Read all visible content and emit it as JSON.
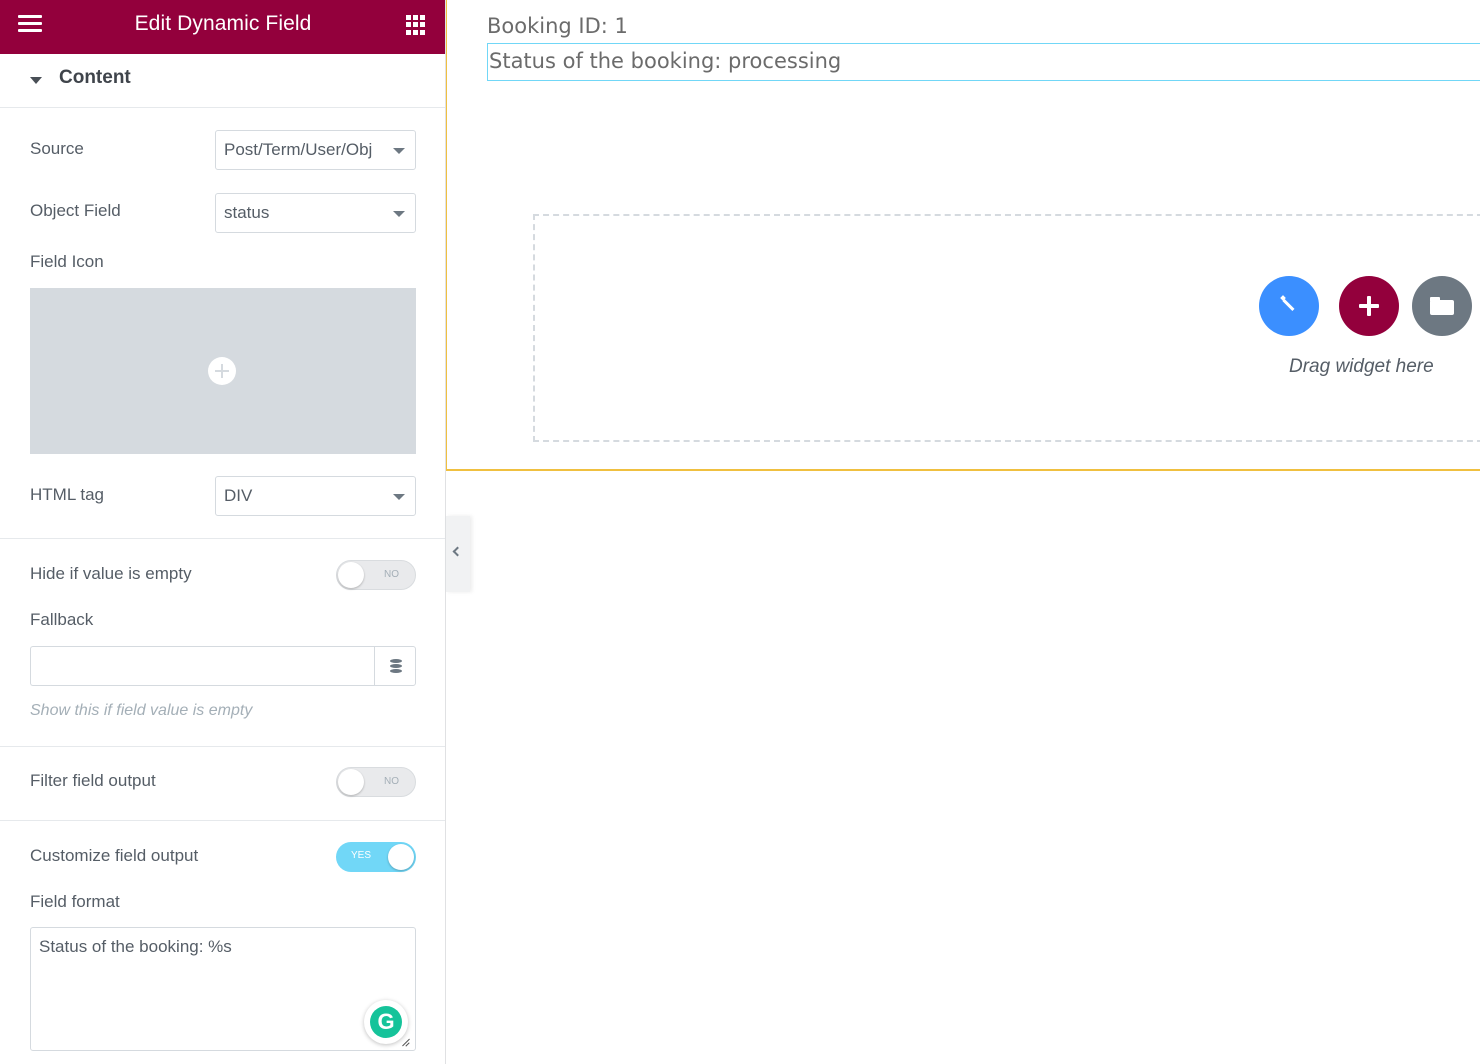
{
  "panel": {
    "title": "Edit Dynamic Field",
    "section_label": "Content",
    "source": {
      "label": "Source",
      "value": "Post/Term/User/Obj"
    },
    "object_field": {
      "label": "Object Field",
      "value": "status"
    },
    "field_icon": {
      "label": "Field Icon"
    },
    "html_tag": {
      "label": "HTML tag",
      "value": "DIV"
    },
    "hide_if_empty": {
      "label": "Hide if value is empty",
      "state": "NO"
    },
    "fallback": {
      "label": "Fallback",
      "value": "",
      "help": "Show this if field value is empty"
    },
    "filter_output": {
      "label": "Filter field output",
      "state": "NO"
    },
    "customize_output": {
      "label": "Customize field output",
      "state": "YES"
    },
    "field_format": {
      "label": "Field format",
      "value": "Status of the booking: %s"
    },
    "grammarly_letter": "G"
  },
  "preview": {
    "booking_id": "Booking ID: 1",
    "status_text": "Status of the booking: processing",
    "drop_zone_text": "Drag widget here"
  },
  "colors": {
    "brand": "#93003c",
    "ai_button": "#3b8fff",
    "library_button": "#6d7882",
    "toggle_on": "#71d7f7",
    "grammarly": "#15c39a"
  }
}
